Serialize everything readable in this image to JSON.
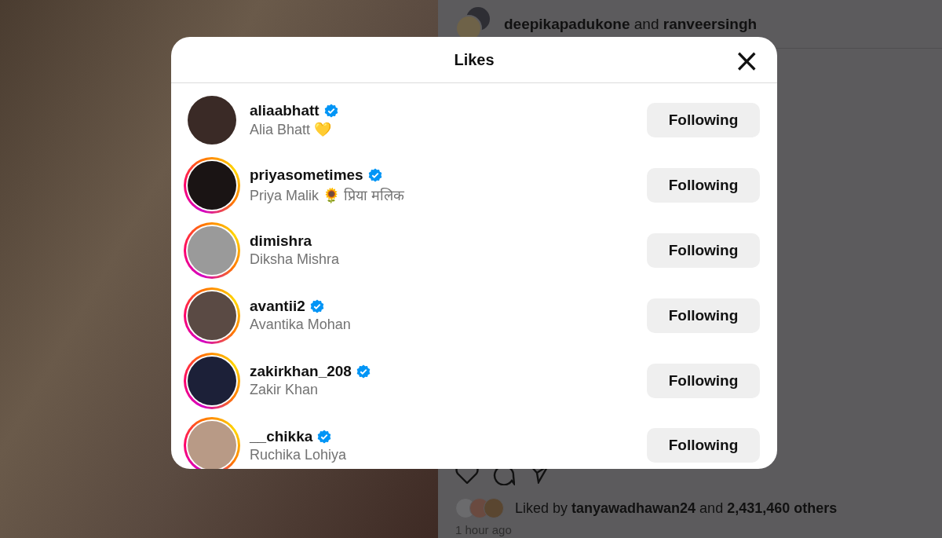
{
  "post": {
    "authors": "**deepikapadukone** and **ranveersingh**",
    "liked_by": "Liked by **tanyawadhawan24** and **2,431,460 others**",
    "time": "1 hour ago"
  },
  "likes_dialog": {
    "title": "Likes",
    "close": "×",
    "users": [
      {
        "username": "aliaabhatt",
        "name": "Alia Bhatt 💛",
        "verified": true,
        "has_story": false,
        "button": "Following"
      },
      {
        "username": "priyasometimes",
        "name": "Priya Malik 🌻 प्रिया मलिक",
        "verified": true,
        "has_story": true,
        "button": "Following"
      },
      {
        "username": "dimishra",
        "name": "Diksha Mishra",
        "verified": false,
        "has_story": true,
        "button": "Following"
      },
      {
        "username": "avantii2",
        "name": "Avantika Mohan",
        "verified": true,
        "has_story": true,
        "button": "Following"
      },
      {
        "username": "zakirkhan_208",
        "name": "Zakir Khan",
        "verified": true,
        "has_story": true,
        "button": "Following"
      },
      {
        "username": "__chikka",
        "name": "Ruchika Lohiya",
        "verified": true,
        "has_story": true,
        "button": "Following"
      }
    ]
  }
}
